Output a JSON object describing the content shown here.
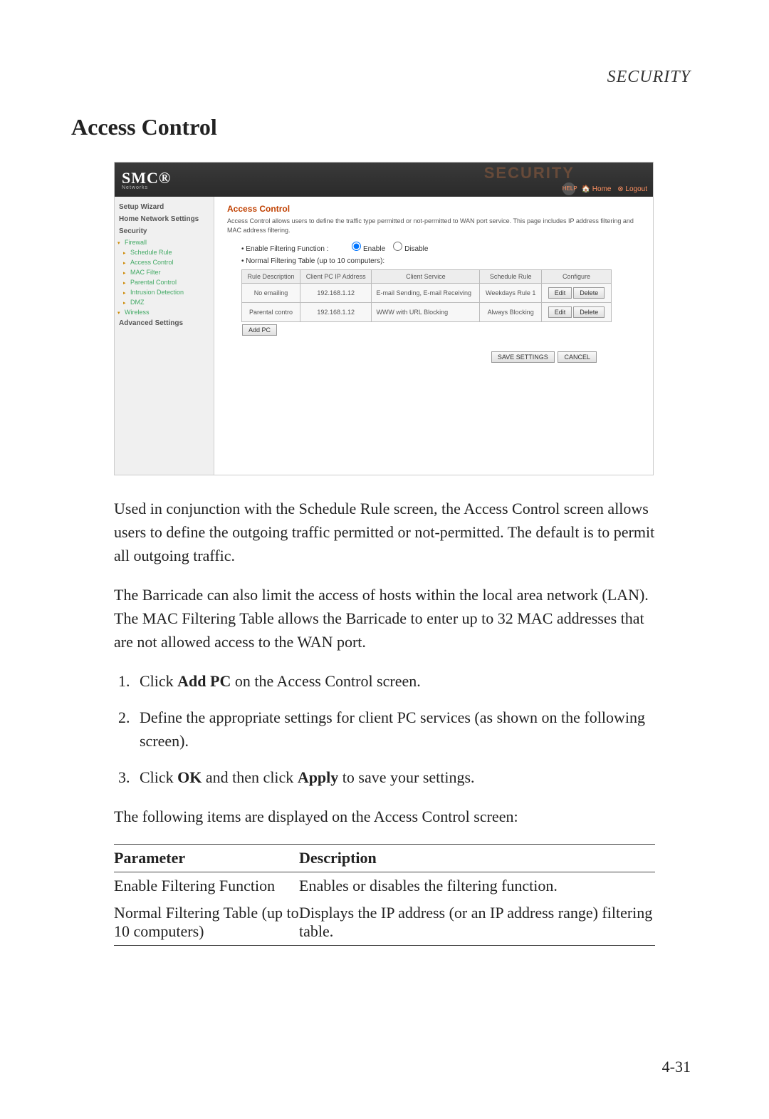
{
  "header_label": "SECURITY",
  "page_title": "Access Control",
  "page_number": "4-31",
  "screenshot": {
    "logo": "SMC®",
    "logo_sub": "Networks",
    "ghost": "SECURITY",
    "help": "HELP",
    "home": "🏠 Home",
    "logout": "⊗ Logout",
    "sidebar": {
      "setup_wizard": "Setup Wizard",
      "home_network": "Home Network Settings",
      "security": "Security",
      "firewall": "Firewall",
      "schedule_rule": "Schedule Rule",
      "access_control": "Access Control",
      "mac_filter": "MAC Filter",
      "parental_control": "Parental Control",
      "intrusion": "Intrusion Detection",
      "dmz": "DMZ",
      "wireless": "Wireless",
      "advanced": "Advanced Settings"
    },
    "content": {
      "heading": "Access Control",
      "description": "Access Control allows users to define the traffic type permitted or not-permitted to WAN port service. This page includes IP address filtering and MAC address filtering.",
      "enable_label": "Enable Filtering Function :",
      "enable_opt": "Enable",
      "disable_opt": "Disable",
      "normal_label": "Normal Filtering Table (up to 10 computers):",
      "table": {
        "headers": {
          "rule": "Rule Description",
          "client_ip": "Client PC IP Address",
          "client_service": "Client Service",
          "schedule": "Schedule Rule",
          "configure": "Configure"
        },
        "rows": [
          {
            "rule": "No emailing",
            "ip": "192.168.1.12",
            "service": "E-mail Sending, E-mail Receiving",
            "schedule": "Weekdays Rule 1"
          },
          {
            "rule": "Parental contro",
            "ip": "192.168.1.12",
            "service": "WWW with URL Blocking",
            "schedule": "Always Blocking"
          }
        ]
      },
      "edit": "Edit",
      "delete": "Delete",
      "add_pc": "Add PC",
      "save": "SAVE SETTINGS",
      "cancel": "CANCEL"
    }
  },
  "body": {
    "p1": "Used in conjunction with the Schedule Rule screen, the Access Control screen allows users to define the outgoing traffic permitted or not-permitted. The default is to permit all outgoing traffic.",
    "p2": "The Barricade can also limit the access of hosts within the local area network (LAN). The MAC Filtering Table allows the Barricade to enter up to 32 MAC addresses that are not allowed access to the WAN port.",
    "steps": {
      "s1a": "Click ",
      "s1b": "Add PC",
      "s1c": " on the Access Control screen.",
      "s2": "Define the appropriate settings for client PC services (as shown on the following screen).",
      "s3a": "Click ",
      "s3b": "OK",
      "s3c": " and then click ",
      "s3d": "Apply",
      "s3e": " to save your settings."
    },
    "p3": "The following items are displayed on the Access Control screen:"
  },
  "param_table": {
    "h1": "Parameter",
    "h2": "Description",
    "r1p": "Enable Filtering Function",
    "r1d": "Enables or disables the filtering function.",
    "r2p": "Normal Filtering Table (up to 10 computers)",
    "r2d": "Displays the IP address (or an IP address range) filtering table."
  }
}
